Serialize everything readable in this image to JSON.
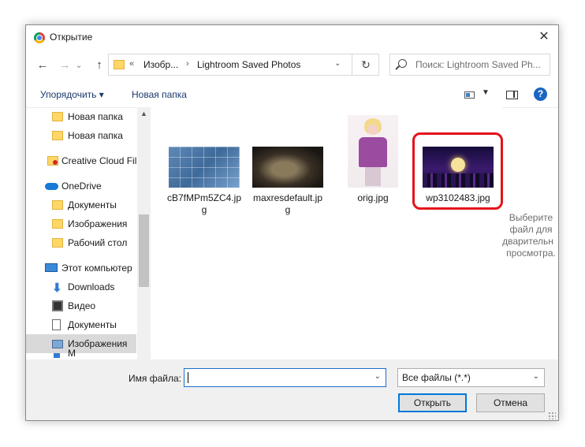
{
  "window": {
    "title": "Открытие",
    "close_glyph": "✕"
  },
  "nav": {
    "back_glyph": "←",
    "forward_glyph": "→",
    "recent_glyph": "⌄",
    "up_glyph": "↑",
    "address": {
      "chevron": "«",
      "segment1": "Изобр...",
      "separator": "›",
      "segment2": "Lightroom Saved Photos",
      "dropdown": "⌄",
      "refresh_glyph": "↻"
    },
    "search_placeholder": "Поиск: Lightroom Saved Ph..."
  },
  "toolbar": {
    "organize_label": "Упорядочить ▾",
    "new_folder_label": "Новая папка",
    "view_dropdown": "▼",
    "help_glyph": "?"
  },
  "sidebar": {
    "scroll_up_glyph": "▲",
    "items": [
      {
        "label": "Новая папка",
        "icon": "folder-icon"
      },
      {
        "label": "Новая папка",
        "icon": "folder-icon"
      },
      {
        "label": "Creative Cloud Fil",
        "icon": "creative-cloud-folder-icon"
      },
      {
        "label": "OneDrive",
        "icon": "onedrive-cloud-icon"
      },
      {
        "label": "Документы",
        "icon": "folder-icon"
      },
      {
        "label": "Изображения",
        "icon": "folder-icon"
      },
      {
        "label": "Рабочий стол",
        "icon": "folder-icon"
      },
      {
        "label": "Этот компьютер",
        "icon": "computer-icon"
      },
      {
        "label": "Downloads",
        "icon": "download-arrow-icon"
      },
      {
        "label": "Видео",
        "icon": "video-icon"
      },
      {
        "label": "Документы",
        "icon": "document-icon"
      },
      {
        "label": "Изображения",
        "icon": "pictures-icon",
        "selected": true
      },
      {
        "label": "М",
        "icon": "music-icon"
      }
    ]
  },
  "files": [
    {
      "name_line1": "cB7fMPm5ZC4.jp",
      "name_line2": "g"
    },
    {
      "name_line1": "maxresdefault.jp",
      "name_line2": "g"
    },
    {
      "name_line1": "orig.jpg",
      "name_line2": ""
    },
    {
      "name_line1": "wp3102483.jpg",
      "name_line2": "",
      "highlighted": true
    }
  ],
  "preview": {
    "lines": [
      "Выберите",
      "файл для",
      "дварительн",
      "просмотра."
    ]
  },
  "bottom": {
    "filename_label": "Имя файла:",
    "filename_value": "",
    "filetype_value": "Все файлы (*.*)",
    "open_button": "Открыть",
    "cancel_button": "Отмена"
  },
  "colors": {
    "highlight_box": "#e3131b",
    "primary_button_border": "#0078d7",
    "selected_nav": "#d9d9d9"
  }
}
